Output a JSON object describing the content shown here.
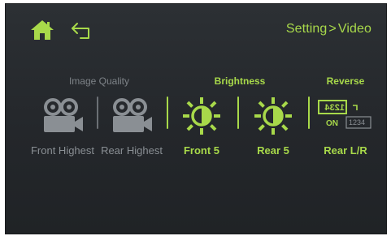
{
  "header": {
    "home_icon": "home-icon",
    "back_icon": "back-arrow-icon",
    "breadcrumb": {
      "parent": "Setting",
      "separator": ">",
      "current": "Video"
    }
  },
  "groups": {
    "image_quality": {
      "title": "Image Quality"
    },
    "brightness": {
      "title": "Brightness"
    },
    "reverse": {
      "title": "Reverse"
    }
  },
  "tiles": [
    {
      "icon": "camera-icon",
      "label": "Front Highest"
    },
    {
      "icon": "camera-icon",
      "label": "Rear Highest"
    },
    {
      "icon": "sun-icon",
      "label": "Front 5"
    },
    {
      "icon": "sun-icon",
      "label": "Rear 5"
    },
    {
      "icon": "mirror-reverse-icon",
      "label": "Rear L/R",
      "mirror_text": "1234",
      "on_text": "ON",
      "normal_text": "1234"
    }
  ],
  "colors": {
    "accent": "#a8d94a",
    "inactive": "#8a8f94",
    "background": "#2a2e32"
  }
}
